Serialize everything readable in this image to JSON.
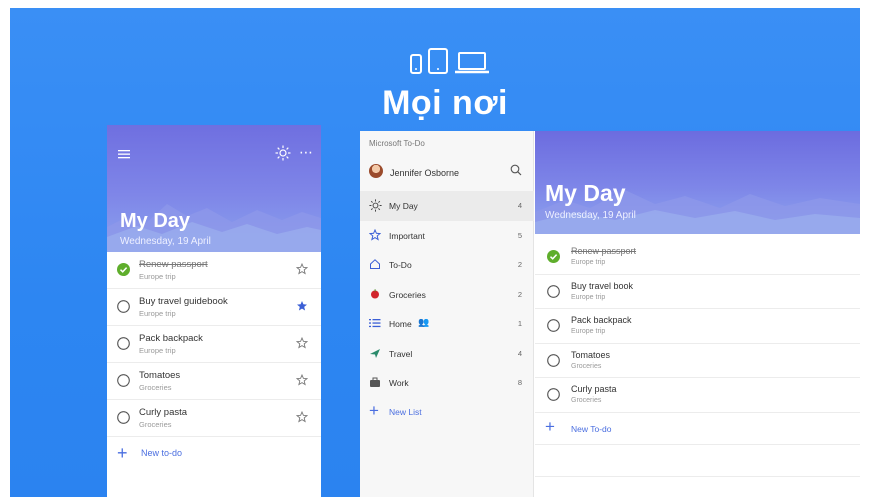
{
  "hero": {
    "title": "Mọi nơi",
    "icons": [
      "phone-icon",
      "tablet-icon",
      "laptop-icon"
    ]
  },
  "colors": {
    "banner": "#2d86f2",
    "accent": "#4a6ee0",
    "hero_purple": "#7379e4",
    "done_green": "#5fae2c",
    "star_blue": "#3b5fd6"
  },
  "phone": {
    "title": "My Day",
    "date": "Wednesday, 19 April",
    "tasks": [
      {
        "title": "Renew passport",
        "list": "Europe trip",
        "done": true,
        "starred": false
      },
      {
        "title": "Buy travel guidebook",
        "list": "Europe trip",
        "done": false,
        "starred": true
      },
      {
        "title": "Pack backpack",
        "list": "Europe trip",
        "done": false,
        "starred": false
      },
      {
        "title": "Tomatoes",
        "list": "Groceries",
        "done": false,
        "starred": false
      },
      {
        "title": "Curly pasta",
        "list": "Groceries",
        "done": false,
        "starred": false
      }
    ],
    "new_todo": "New to-do"
  },
  "desktop": {
    "app_name": "Microsoft To-Do",
    "user_name": "Jennifer Osborne",
    "nav": [
      {
        "label": "My Day",
        "count": "4",
        "icon": "sun-icon"
      },
      {
        "label": "Important",
        "count": "5",
        "icon": "star-icon"
      },
      {
        "label": "To-Do",
        "count": "2",
        "icon": "home-icon"
      },
      {
        "label": "Groceries",
        "count": "2",
        "icon": "apple-icon"
      },
      {
        "label": "Home",
        "count": "1",
        "icon": "list-icon"
      },
      {
        "label": "Travel",
        "count": "4",
        "icon": "plane-icon"
      },
      {
        "label": "Work",
        "count": "8",
        "icon": "briefcase-icon"
      }
    ],
    "new_list": "New List",
    "main": {
      "title": "My Day",
      "date": "Wednesday, 19 April",
      "tasks": [
        {
          "title": "Renew passport",
          "list": "Europe trip",
          "done": true
        },
        {
          "title": "Buy travel book",
          "list": "Europe trip",
          "done": false
        },
        {
          "title": "Pack backpack",
          "list": "Europe trip",
          "done": false
        },
        {
          "title": "Tomatoes",
          "list": "Groceries",
          "done": false
        },
        {
          "title": "Curly pasta",
          "list": "Groceries",
          "done": false
        }
      ],
      "new_todo": "New To-do"
    }
  }
}
